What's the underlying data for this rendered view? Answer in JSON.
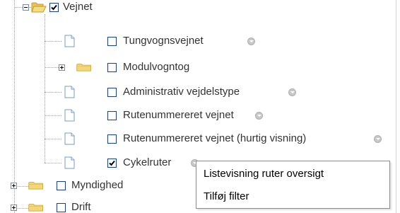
{
  "tree": {
    "items": [
      {
        "label": "Vejnet",
        "type": "folder",
        "expanded": true,
        "checked": true
      },
      {
        "label": "Tungvognsvejnet",
        "type": "layer",
        "checked": false,
        "has_info": true
      },
      {
        "label": "Modulvogntog",
        "type": "folder",
        "expanded": false,
        "checked": false
      },
      {
        "label": "Administrativ vejdelstype",
        "type": "layer",
        "checked": false,
        "has_info": true
      },
      {
        "label": "Rutenummereret vejnet",
        "type": "layer",
        "checked": false,
        "has_info": true
      },
      {
        "label": "Rutenummereret vejnet (hurtig visning)",
        "type": "layer",
        "checked": false,
        "has_info": true
      },
      {
        "label": "Cykelruter",
        "type": "layer",
        "checked": true,
        "has_info": true
      },
      {
        "label": "Myndighed",
        "type": "folder",
        "expanded": false,
        "checked": false
      },
      {
        "label": "Drift",
        "type": "folder",
        "expanded": false,
        "checked": false
      }
    ]
  },
  "context_menu": {
    "items": [
      {
        "label": "Listevisning ruter oversigt"
      },
      {
        "label": "Tilføj filter"
      }
    ]
  },
  "colors": {
    "folder_fill": "#f3d774",
    "folder_edge": "#c39a2c",
    "page_fill": "#ffffff",
    "page_edge": "#7a9acb",
    "checkbox_border": "#1c3f8c",
    "text": "#333333"
  }
}
